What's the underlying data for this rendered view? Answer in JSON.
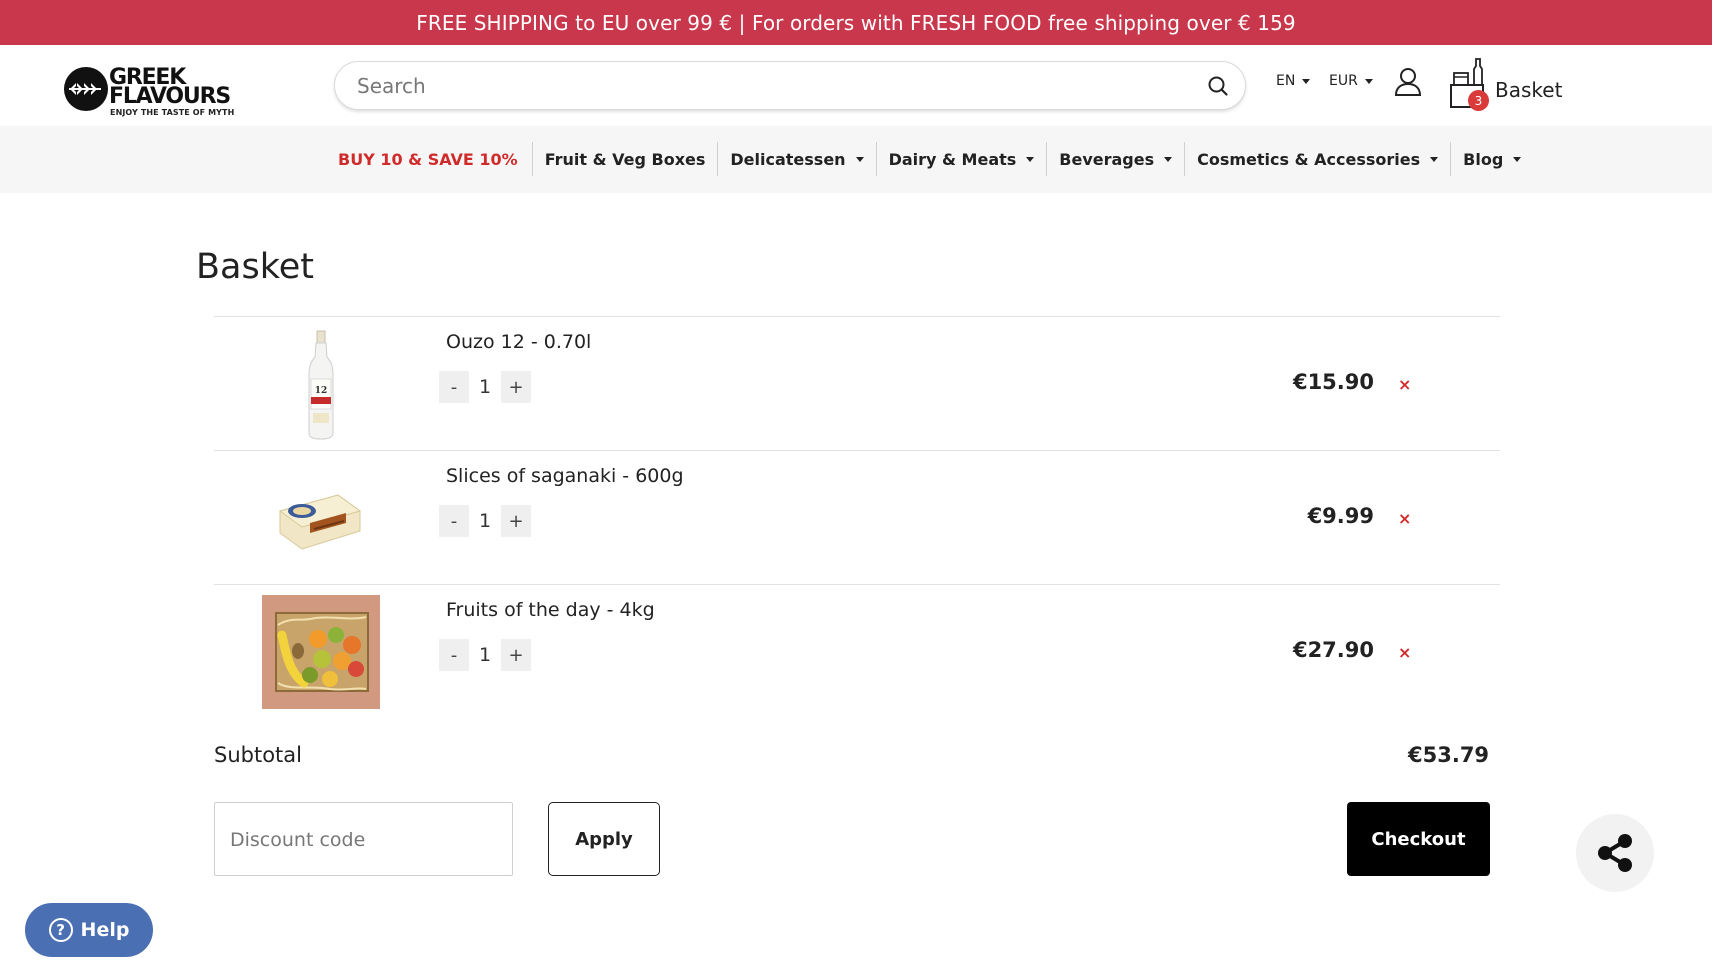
{
  "promo_bar": {
    "text": "FREE SHIPPING to EU over 99 € | For orders with FRESH FOOD free shipping over € 159"
  },
  "logo": {
    "line1": "GREEK",
    "line2": "FLAVOURS",
    "tagline": "ENJOY THE TASTE OF MYTH"
  },
  "search": {
    "placeholder": "Search",
    "icon": "search-icon"
  },
  "header": {
    "language": "EN",
    "currency": "EUR",
    "account_icon": "user-icon",
    "basket_count": "3",
    "basket_label": "Basket"
  },
  "nav": {
    "items": [
      {
        "label": "BUY 10 & SAVE 10%",
        "highlight": true,
        "dropdown": false
      },
      {
        "label": "Fruit & Veg Boxes",
        "dropdown": false
      },
      {
        "label": "Delicatessen",
        "dropdown": true
      },
      {
        "label": "Dairy & Meats",
        "dropdown": true
      },
      {
        "label": "Beverages",
        "dropdown": true
      },
      {
        "label": "Cosmetics & Accessories",
        "dropdown": true
      },
      {
        "label": "Blog",
        "dropdown": true
      }
    ]
  },
  "page": {
    "title": "Basket"
  },
  "basket": {
    "items": [
      {
        "name": "Ouzo 12 - 0.70l",
        "quantity": "1",
        "price": "€15.90",
        "minus": "-",
        "plus": "+",
        "remove": "×"
      },
      {
        "name": "Slices of saganaki - 600g",
        "quantity": "1",
        "price": "€9.99",
        "minus": "-",
        "plus": "+",
        "remove": "×"
      },
      {
        "name": "Fruits of the day - 4kg",
        "quantity": "1",
        "price": "€27.90",
        "minus": "-",
        "plus": "+",
        "remove": "×"
      }
    ],
    "subtotal_label": "Subtotal",
    "subtotal_value": "€53.79",
    "discount_placeholder": "Discount code",
    "apply_label": "Apply",
    "checkout_label": "Checkout"
  },
  "help": {
    "label": "Help",
    "icon_glyph": "?"
  },
  "colors": {
    "promo_bg": "#c8374b",
    "accent_red": "#d02b2b",
    "help_bg": "#4a6fb3",
    "checkout_bg": "#000000"
  }
}
